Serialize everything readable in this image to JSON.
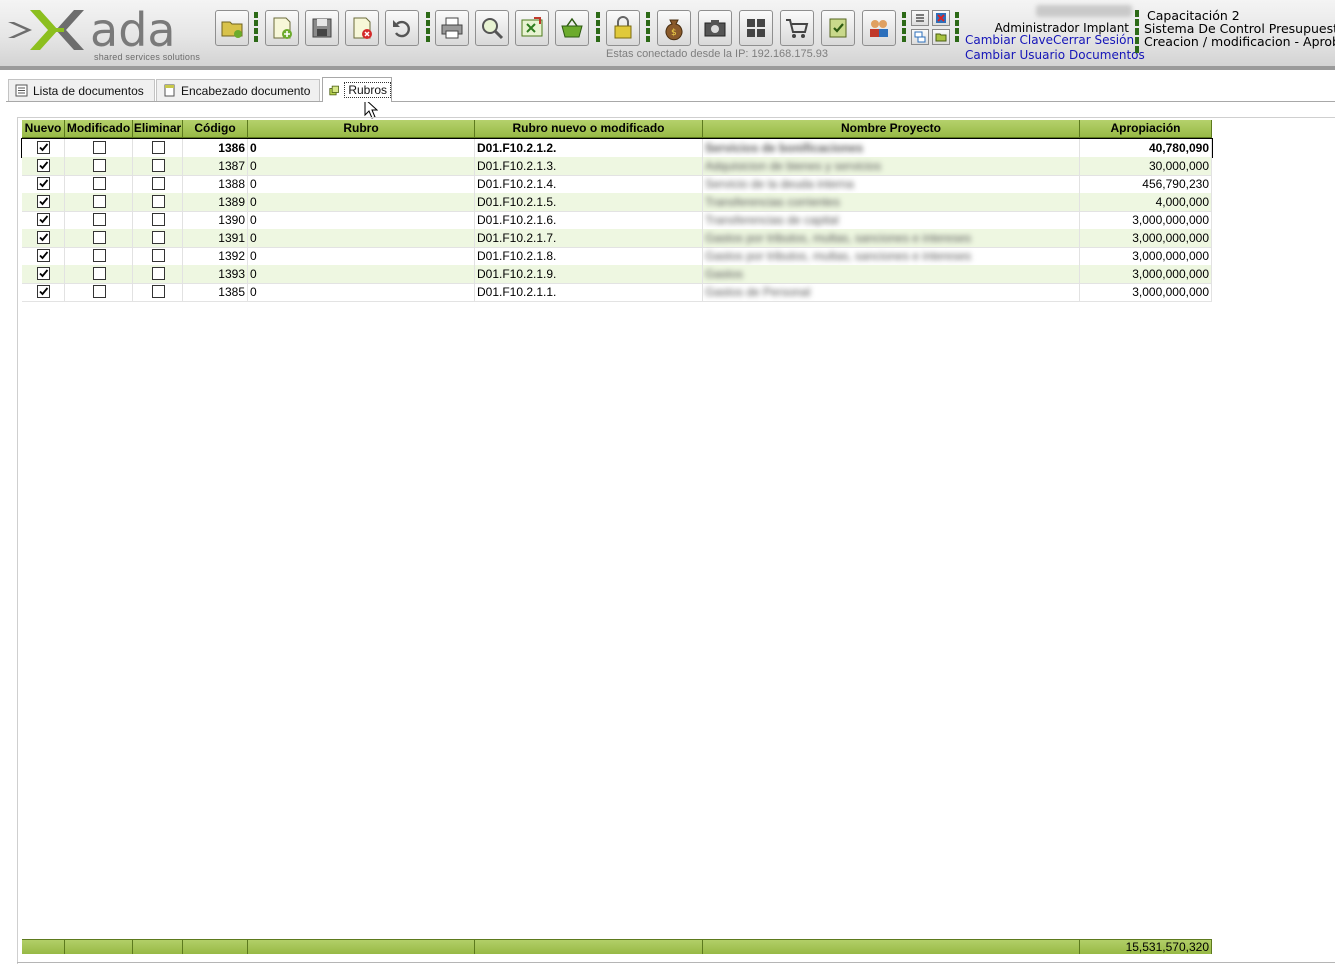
{
  "app": {
    "logo_text": "ada",
    "logo_tagline": "shared services solutions",
    "ip_text": "Estas conectado desde la IP: 192.168.175.93",
    "user_name": "Administrador Implant",
    "links": {
      "change_password": "Cambiar Clave",
      "logout": "Cerrar Sesión",
      "change_user": "Cambiar Usuario",
      "documents": "Documentos"
    },
    "info": {
      "line1": "Capacitación 2",
      "line2": "Sistema De Control Presupuestal",
      "line3": "Creacion / modificacion - Aprobac"
    }
  },
  "toolbar": {
    "buttons": [
      {
        "name": "open-folder-icon"
      },
      {
        "name": "new-document-icon"
      },
      {
        "name": "save-icon"
      },
      {
        "name": "delete-icon"
      },
      {
        "name": "undo-icon"
      },
      {
        "name": "print-icon"
      },
      {
        "name": "search-icon"
      },
      {
        "name": "export-excel-icon"
      },
      {
        "name": "basket-icon"
      },
      {
        "name": "lock-icon"
      },
      {
        "name": "money-bag-icon"
      },
      {
        "name": "camera-icon"
      },
      {
        "name": "grid-icon"
      },
      {
        "name": "cart-icon"
      },
      {
        "name": "approve-icon"
      },
      {
        "name": "users-icon"
      }
    ]
  },
  "tabs": [
    {
      "label": "Lista de documentos",
      "active": false
    },
    {
      "label": "Encabezado documento",
      "active": false
    },
    {
      "label": "Rubros",
      "active": true
    }
  ],
  "grid": {
    "columns": [
      "Nuevo",
      "Modificado",
      "Eliminar",
      "Código",
      "Rubro",
      "Rubro nuevo o modificado",
      "Nombre Proyecto",
      "Apropiación"
    ],
    "rows": [
      {
        "nuevo": true,
        "modificado": false,
        "eliminar": false,
        "codigo": "1386",
        "rubro": "0",
        "rubro_nuevo": "D01.F10.2.1.2.",
        "nombre": "Servicios de bonificaciones",
        "apropiacion": "40,780,090"
      },
      {
        "nuevo": true,
        "modificado": false,
        "eliminar": false,
        "codigo": "1387",
        "rubro": "0",
        "rubro_nuevo": "D01.F10.2.1.3.",
        "nombre": "Adquisicion de bienes y servicios",
        "apropiacion": "30,000,000"
      },
      {
        "nuevo": true,
        "modificado": false,
        "eliminar": false,
        "codigo": "1388",
        "rubro": "0",
        "rubro_nuevo": "D01.F10.2.1.4.",
        "nombre": "Servicio de la deuda interna",
        "apropiacion": "456,790,230"
      },
      {
        "nuevo": true,
        "modificado": false,
        "eliminar": false,
        "codigo": "1389",
        "rubro": "0",
        "rubro_nuevo": "D01.F10.2.1.5.",
        "nombre": "Transferencias corrientes",
        "apropiacion": "4,000,000"
      },
      {
        "nuevo": true,
        "modificado": false,
        "eliminar": false,
        "codigo": "1390",
        "rubro": "0",
        "rubro_nuevo": "D01.F10.2.1.6.",
        "nombre": "Transferencias de capital",
        "apropiacion": "3,000,000,000"
      },
      {
        "nuevo": true,
        "modificado": false,
        "eliminar": false,
        "codigo": "1391",
        "rubro": "0",
        "rubro_nuevo": "D01.F10.2.1.7.",
        "nombre": "Gastos por tributos, multas, sanciones e intereses",
        "apropiacion": "3,000,000,000"
      },
      {
        "nuevo": true,
        "modificado": false,
        "eliminar": false,
        "codigo": "1392",
        "rubro": "0",
        "rubro_nuevo": "D01.F10.2.1.8.",
        "nombre": "Gastos por tributos, multas, sanciones e intereses",
        "apropiacion": "3,000,000,000"
      },
      {
        "nuevo": true,
        "modificado": false,
        "eliminar": false,
        "codigo": "1393",
        "rubro": "0",
        "rubro_nuevo": "D01.F10.2.1.9.",
        "nombre": "Gastos",
        "apropiacion": "3,000,000,000"
      },
      {
        "nuevo": true,
        "modificado": false,
        "eliminar": false,
        "codigo": "1385",
        "rubro": "0",
        "rubro_nuevo": "D01.F10.2.1.1.",
        "nombre": "Gastos de Personal",
        "apropiacion": "3,000,000,000"
      }
    ],
    "total_apropiacion": "15,531,570,320"
  },
  "colors": {
    "header_green": "#9cbd4a",
    "row_alt": "#eef7e1",
    "link_blue": "#1515b8",
    "separator_green": "#2d6a17"
  }
}
